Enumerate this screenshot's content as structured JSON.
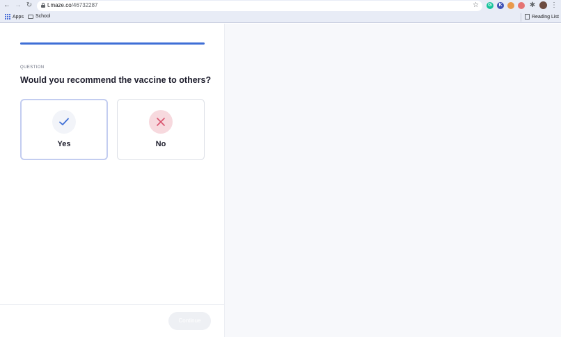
{
  "browser": {
    "url_host": "t.maze.co",
    "url_path": "/46732287",
    "nav_icons": [
      "back-arrow-icon",
      "forward-arrow-icon",
      "reload-icon"
    ],
    "extensions": [
      {
        "name": "grammarly-icon",
        "color": "#15c39a",
        "glyph": "G"
      },
      {
        "name": "extension-blue-icon",
        "color": "#3f51b5",
        "glyph": "K"
      },
      {
        "name": "extension-orange-icon",
        "color": "#e99a4b",
        "glyph": "•"
      },
      {
        "name": "extension-badge-icon",
        "color": "#e57373",
        "glyph": "•"
      }
    ],
    "bookmarks": {
      "apps_label": "Apps",
      "school_label": "School",
      "reading_list_label": "Reading List"
    }
  },
  "page": {
    "progress_fraction": 1.0,
    "question_label": "QUESTION",
    "question_title": "Would you recommend the vaccine to others?",
    "options": [
      {
        "label": "Yes",
        "icon": "checkmark-icon",
        "selected": true
      },
      {
        "label": "No",
        "icon": "cross-icon",
        "selected": false
      }
    ],
    "continue_label": "Continue"
  },
  "colors": {
    "accent": "#3f6fd6",
    "no_circle": "#f7d9de",
    "cross": "#d9546e",
    "check": "#3f6fd6"
  }
}
